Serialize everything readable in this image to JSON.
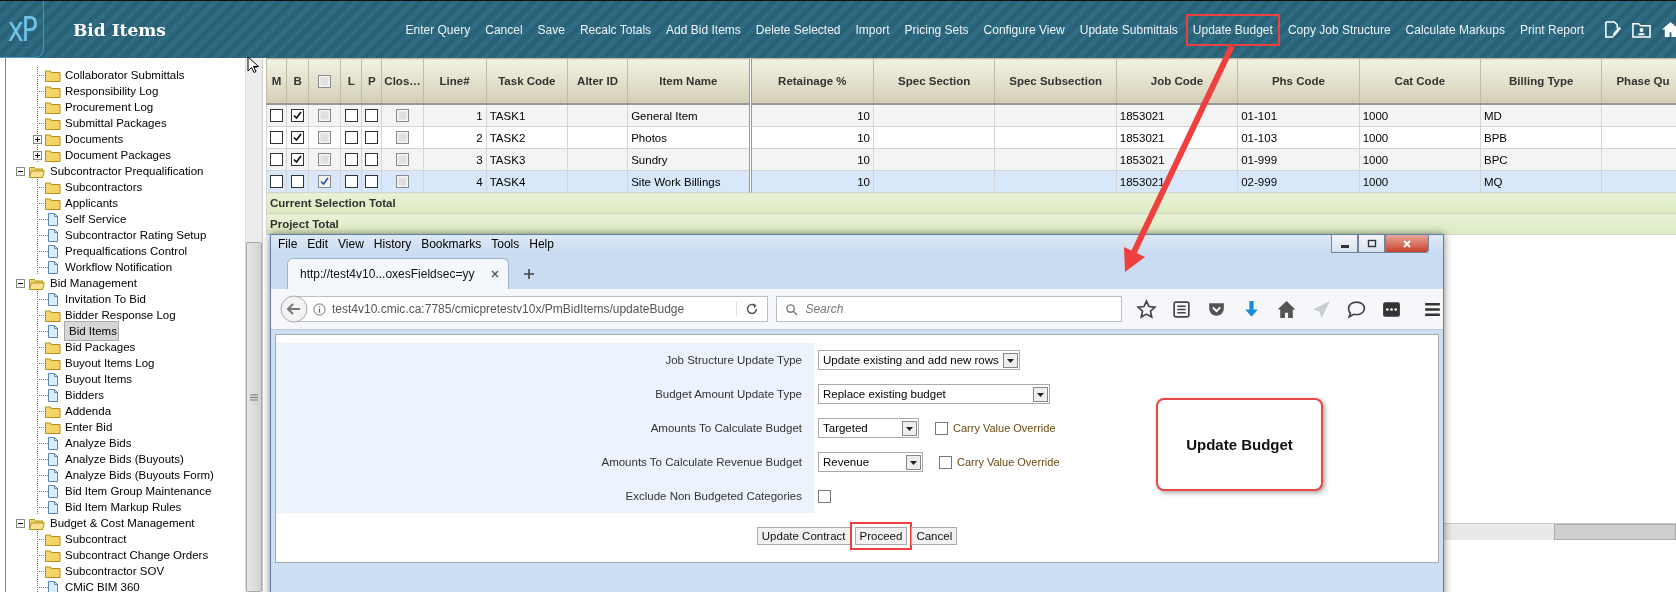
{
  "app": {
    "logo": "xP",
    "title": "Bid Items"
  },
  "toolbar": [
    {
      "label": "Enter Query",
      "highlighted": false
    },
    {
      "label": "Cancel",
      "highlighted": false
    },
    {
      "label": "Save",
      "highlighted": false
    },
    {
      "label": "Recalc Totals",
      "highlighted": false
    },
    {
      "label": "Add Bid Items",
      "highlighted": false
    },
    {
      "label": "Delete Selected",
      "highlighted": false
    },
    {
      "label": "Import",
      "highlighted": false
    },
    {
      "label": "Pricing Sets",
      "highlighted": false
    },
    {
      "label": "Configure View",
      "highlighted": false
    },
    {
      "label": "Update Submittals",
      "highlighted": false
    },
    {
      "label": "Update Budget",
      "highlighted": true
    },
    {
      "label": "Copy Job Structure",
      "highlighted": false
    },
    {
      "label": "Calculate Markups",
      "highlighted": false
    },
    {
      "label": "Print Report",
      "highlighted": false
    }
  ],
  "sidebar": {
    "tree": [
      {
        "children": [
          {
            "label": "Collaborator Submittals",
            "kind": "folder",
            "selected": false
          },
          {
            "label": "Responsibility Log",
            "kind": "folder",
            "selected": false
          },
          {
            "label": "Procurement Log",
            "kind": "folder",
            "selected": false
          },
          {
            "label": "Submittal Packages",
            "kind": "folder",
            "selected": false
          },
          {
            "label": "Documents",
            "kind": "folder",
            "expanded": false,
            "selected": false
          },
          {
            "label": "Document Packages",
            "kind": "folder",
            "expanded": false,
            "selected": false
          }
        ]
      },
      {
        "label": "Subcontractor Prequalification",
        "kind": "folder",
        "expanded": true,
        "selected": false,
        "children": [
          {
            "label": "Subcontractors",
            "kind": "folder",
            "selected": false
          },
          {
            "label": "Applicants",
            "kind": "folder",
            "selected": false
          },
          {
            "label": "Self Service",
            "kind": "page",
            "selected": false
          },
          {
            "label": "Subcontractor Rating Setup",
            "kind": "page",
            "selected": false
          },
          {
            "label": "Prequalfications Control",
            "kind": "page",
            "selected": false
          },
          {
            "label": "Workflow Notification",
            "kind": "page",
            "selected": false
          }
        ]
      },
      {
        "label": "Bid Management",
        "kind": "folder",
        "expanded": true,
        "selected": false,
        "children": [
          {
            "label": "Invitation To Bid",
            "kind": "page",
            "selected": false
          },
          {
            "label": "Bidder Response Log",
            "kind": "folder",
            "selected": false
          },
          {
            "label": "Bid Items",
            "kind": "page",
            "selected": true
          },
          {
            "label": "Bid Packages",
            "kind": "folder",
            "selected": false
          },
          {
            "label": "Buyout Items Log",
            "kind": "folder",
            "selected": false
          },
          {
            "label": "Buyout Items",
            "kind": "page",
            "selected": false
          },
          {
            "label": "Bidders",
            "kind": "page",
            "selected": false
          },
          {
            "label": "Addenda",
            "kind": "folder",
            "selected": false
          },
          {
            "label": "Enter Bid",
            "kind": "folder",
            "selected": false
          },
          {
            "label": "Analyze Bids",
            "kind": "page",
            "selected": false
          },
          {
            "label": "Analyze Bids (Buyouts)",
            "kind": "page",
            "selected": false
          },
          {
            "label": "Analyze Bids (Buyouts Form)",
            "kind": "page",
            "selected": false
          },
          {
            "label": "Bid Item Group Maintenance",
            "kind": "page",
            "selected": false
          },
          {
            "label": "Bid Item Markup Rules",
            "kind": "page",
            "selected": false
          }
        ]
      },
      {
        "label": "Budget & Cost Management",
        "kind": "folder",
        "expanded": true,
        "selected": false,
        "children": [
          {
            "label": "Subcontract",
            "kind": "folder",
            "selected": false
          },
          {
            "label": "Subcontract Change Orders",
            "kind": "folder",
            "selected": false
          },
          {
            "label": "Subcontractor SOV",
            "kind": "folder",
            "selected": false
          },
          {
            "label": "CMiC BIM 360",
            "kind": "page",
            "selected": false
          }
        ]
      }
    ]
  },
  "grid": {
    "columns": [
      {
        "label": "M"
      },
      {
        "label": "B"
      },
      {
        "kind": "checkbox",
        "checked": false
      },
      {
        "label": "L"
      },
      {
        "label": "P"
      },
      {
        "label": "Clos…"
      },
      {
        "label": "Line#"
      },
      {
        "label": "Task Code"
      },
      {
        "label": "Alter ID"
      },
      {
        "label": "Item Name"
      },
      {
        "label": "Retainage %"
      },
      {
        "label": "Spec Section"
      },
      {
        "label": "Spec Subsection"
      },
      {
        "label": "Job Code"
      },
      {
        "label": "Phs Code"
      },
      {
        "label": "Cat Code"
      },
      {
        "label": "Billing Type"
      },
      {
        "label": "Phase Qu"
      }
    ],
    "rows": [
      {
        "selected": false,
        "m": false,
        "b": true,
        "c": false,
        "l": false,
        "p": false,
        "closed": false,
        "line": "1",
        "task_code": "TASK1",
        "item_name": "General Item",
        "retainage": "10",
        "job_code": "1853021",
        "phs_code": "01-101",
        "cat_code": "1000",
        "billing_type": "MD"
      },
      {
        "selected": false,
        "m": false,
        "b": true,
        "c": false,
        "l": false,
        "p": false,
        "closed": false,
        "line": "2",
        "task_code": "TASK2",
        "item_name": "Photos",
        "retainage": "10",
        "job_code": "1853021",
        "phs_code": "01-103",
        "cat_code": "1000",
        "billing_type": "BPB"
      },
      {
        "selected": false,
        "m": false,
        "b": true,
        "c": false,
        "l": false,
        "p": false,
        "closed": false,
        "line": "3",
        "task_code": "TASK3",
        "item_name": "Sundry",
        "retainage": "10",
        "job_code": "1853021",
        "phs_code": "01-999",
        "cat_code": "1000",
        "billing_type": "BPC"
      },
      {
        "selected": true,
        "m": false,
        "b": false,
        "c": true,
        "l": false,
        "p": false,
        "closed": false,
        "line": "4",
        "task_code": "TASK4",
        "item_name": "Site Work Billings",
        "retainage": "10",
        "job_code": "1853021",
        "phs_code": "02-999",
        "cat_code": "1000",
        "billing_type": "MQ"
      }
    ],
    "totals": [
      "Current Selection Total",
      "Project Total"
    ]
  },
  "browser": {
    "menu": [
      "File",
      "Edit",
      "View",
      "History",
      "Bookmarks",
      "Tools",
      "Help"
    ],
    "tab": "http://test4v10...oxesFieldsec=yy",
    "url": "test4v10.cmic.ca:7785/cmicpretestv10x/PmBidItems/updateBudge",
    "search": {
      "placeholder": "Search"
    },
    "form": {
      "fields": [
        {
          "label": "Job Structure Update Type",
          "kind": "select",
          "value": "Update existing and add new rows"
        },
        {
          "label": "Budget Amount Update Type",
          "kind": "select",
          "value": "Replace existing budget"
        },
        {
          "label": "Amounts To Calculate Budget",
          "kind": "select",
          "value": "Targeted",
          "option": {
            "label": "Carry Value Override",
            "checked": false
          }
        },
        {
          "label": "Amounts To Calculate Revenue Budget",
          "kind": "select",
          "value": "Revenue",
          "option": {
            "label": "Carry Value Override",
            "checked": false
          }
        },
        {
          "label": "Exclude Non Budgeted Categories",
          "kind": "checkbox",
          "checked": false
        }
      ],
      "buttons": [
        {
          "label": "Update Contract",
          "highlighted": false
        },
        {
          "label": "Proceed",
          "highlighted": true
        },
        {
          "label": "Cancel",
          "highlighted": false
        }
      ]
    }
  },
  "callout": {
    "text": "Update Budget"
  }
}
